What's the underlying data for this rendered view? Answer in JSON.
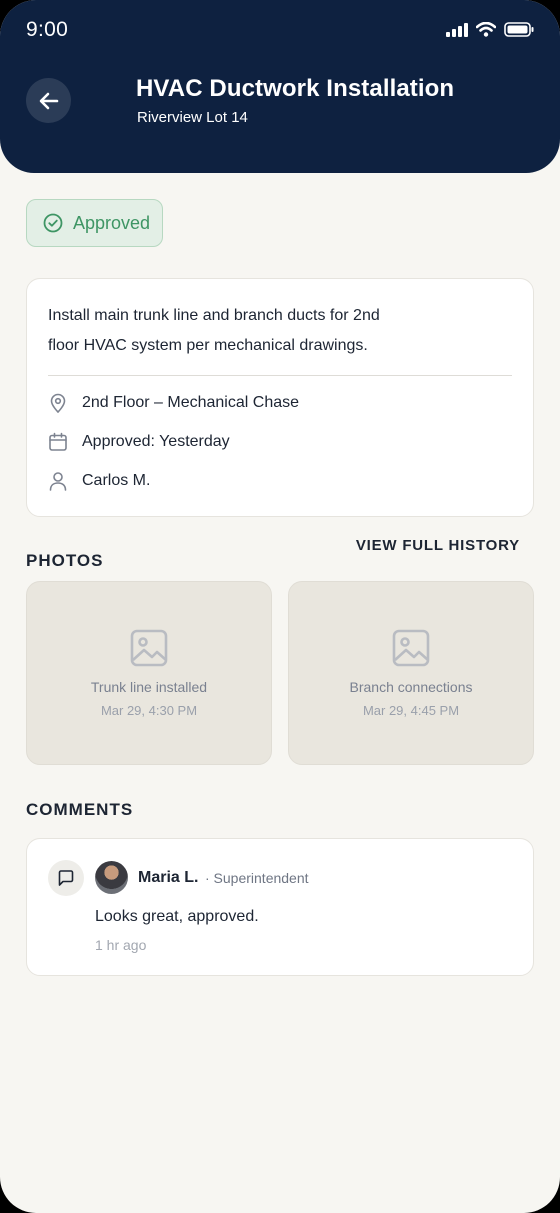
{
  "status_bar": {
    "time": "9:00"
  },
  "header": {
    "title": "HVAC Ductwork Installation",
    "subtitle": "Riverview Lot 14"
  },
  "status_badge": {
    "label": "Approved",
    "color": "#3e9564"
  },
  "details": {
    "description_line1": "Install main trunk line and branch ducts for 2nd",
    "description_line2": "floor HVAC system per mechanical drawings.",
    "location": "2nd Floor – Mechanical Chase",
    "approved": "Approved: Yesterday",
    "assignee": "Carlos M."
  },
  "photos_section": {
    "title": "PHOTOS",
    "history_link": "VIEW FULL HISTORY",
    "items": [
      {
        "label": "Trunk line installed",
        "time": "Mar 29, 4:30 PM"
      },
      {
        "label": "Branch connections",
        "time": "Mar 29, 4:45 PM"
      }
    ]
  },
  "comments_section": {
    "title": "COMMENTS",
    "items": [
      {
        "author": "Maria L.",
        "role": "· Superintendent",
        "text": "Looks great, approved.",
        "time": "1 hr ago"
      }
    ]
  },
  "colors": {
    "header_bg": "#0e2140",
    "page_bg": "#f7f6f2",
    "approved_green": "#3e9564"
  }
}
